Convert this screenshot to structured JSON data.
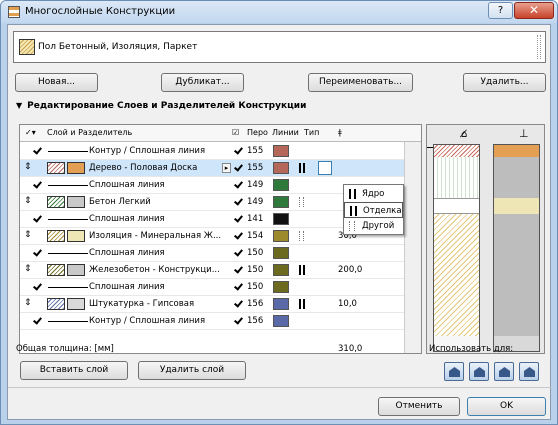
{
  "window": {
    "title": "Многослойные Конструкции",
    "help": "?",
    "close": "✕"
  },
  "name_field": {
    "value": "Пол Бетонный, Изоляция, Паркет"
  },
  "buttons": {
    "new": "Новая...",
    "duplicate": "Дубликат...",
    "rename": "Переименовать...",
    "delete": "Удалить...",
    "insert_layer": "Вставить слой",
    "delete_layer": "Удалить слой",
    "cancel": "Отменить",
    "ok": "OK"
  },
  "section": {
    "title": "Редактирование Слоев и Разделителей Конструкции"
  },
  "headers": {
    "layer": "Слой и Разделитель",
    "pen": "Перо",
    "lines": "Линии",
    "type": "Тип",
    "thickness": "ǂ"
  },
  "rows": [
    {
      "kind": "line",
      "label": "Контур / Сплошная линия",
      "pen": "155",
      "color": "#b5675a"
    },
    {
      "kind": "layer",
      "label": "Дерево - Половая Доска",
      "pen": "155",
      "color": "#b5675a",
      "swatch": "#e3a055",
      "fn": "core",
      "thickness": "",
      "selected": true
    },
    {
      "kind": "line",
      "label": "Сплошная линия",
      "pen": "149",
      "color": "#2f7a3a"
    },
    {
      "kind": "layer",
      "label": "Бетон Легкий",
      "pen": "149",
      "color": "#2f7a3a",
      "swatch": "#c9c9c9",
      "fn": "other",
      "thickness": ""
    },
    {
      "kind": "line",
      "label": "Сплошная линия",
      "pen": "141",
      "color": "#111111"
    },
    {
      "kind": "layer",
      "label": "Изоляция - Минеральная Ж...",
      "pen": "154",
      "color": "#9c8a2c",
      "swatch": "#efe6b5",
      "fn": "other",
      "thickness": "30,0"
    },
    {
      "kind": "line",
      "label": "Сплошная линия",
      "pen": "150",
      "color": "#6b6a1e"
    },
    {
      "kind": "layer",
      "label": "Железобетон - Конструкци...",
      "pen": "150",
      "color": "#6b6a1e",
      "swatch": "#c9c9c9",
      "fn": "core",
      "thickness": "200,0"
    },
    {
      "kind": "line",
      "label": "Сплошная линия",
      "pen": "150",
      "color": "#6b6a1e"
    },
    {
      "kind": "layer",
      "label": "Штукатурка - Гипсовая",
      "pen": "156",
      "color": "#5a6aa8",
      "swatch": "#d9d9d9",
      "fn": "core",
      "thickness": "10,0"
    },
    {
      "kind": "line",
      "label": "Контур / Сплошная линия",
      "pen": "156",
      "color": "#5a6aa8"
    }
  ],
  "popup": {
    "items": [
      "Ядро",
      "Отделка",
      "Другой"
    ]
  },
  "total": {
    "label": "Общая толщина: [мм]",
    "value": "310,0"
  },
  "use_for": {
    "label": "Использовать для:"
  }
}
